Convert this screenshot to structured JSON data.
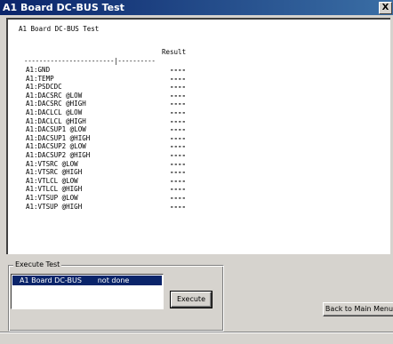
{
  "window": {
    "title": "A1 Board DC-BUS Test",
    "close_label": "X"
  },
  "report": {
    "heading": "A1 Board DC-BUS Test",
    "result_header": "Result",
    "separator": "------------------------|----------",
    "rows": [
      {
        "name": "A1:GND",
        "result": "----"
      },
      {
        "name": "A1:TEMP",
        "result": "----"
      },
      {
        "name": "A1:PSDCDC",
        "result": "----"
      },
      {
        "name": "A1:DACSRC @LOW",
        "result": "----"
      },
      {
        "name": "A1:DACSRC @HIGH",
        "result": "----"
      },
      {
        "name": "A1:DACLCL @LOW",
        "result": "----"
      },
      {
        "name": "A1:DACLCL @HIGH",
        "result": "----"
      },
      {
        "name": "A1:DACSUP1 @LOW",
        "result": "----"
      },
      {
        "name": "A1:DACSUP1 @HIGH",
        "result": "----"
      },
      {
        "name": "A1:DACSUP2 @LOW",
        "result": "----"
      },
      {
        "name": "A1:DACSUP2 @HIGH",
        "result": "----"
      },
      {
        "name": "A1:VTSRC @LOW",
        "result": "----"
      },
      {
        "name": "A1:VTSRC @HIGH",
        "result": "----"
      },
      {
        "name": "A1:VTLCL @LOW",
        "result": "----"
      },
      {
        "name": "A1:VTLCL @HIGH",
        "result": "----"
      },
      {
        "name": "A1:VTSUP @LOW",
        "result": "----"
      },
      {
        "name": "A1:VTSUP @HIGH",
        "result": "----"
      }
    ]
  },
  "execute_group": {
    "label": "Execute Test",
    "test_item": "A1 Board DC-BUS       not done",
    "execute_label": "Execute"
  },
  "back_button_label": "Back to Main Menu"
}
